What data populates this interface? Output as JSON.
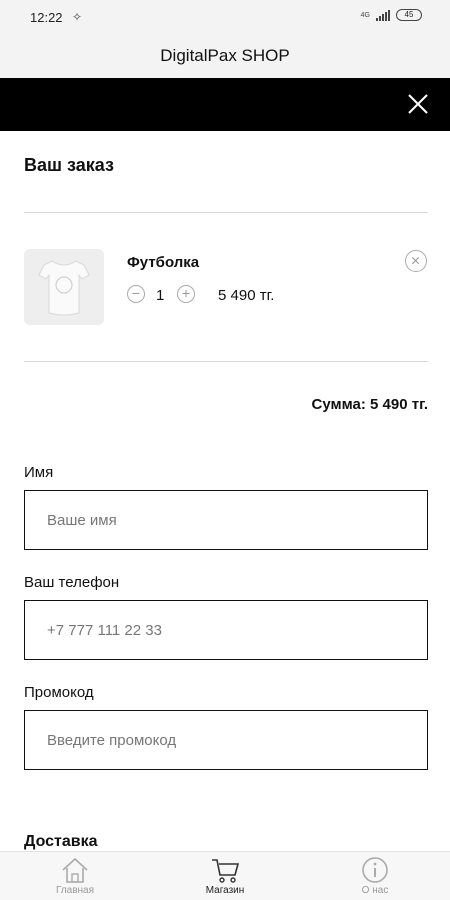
{
  "status_bar": {
    "time": "12:22",
    "battery": "45",
    "network": "4G"
  },
  "app": {
    "title": "DigitalPax SHOP"
  },
  "order": {
    "title": "Ваш заказ",
    "items": [
      {
        "name": "Футболка",
        "quantity": "1",
        "price": "5 490 тг.",
        "minus": "−",
        "plus": "+"
      }
    ],
    "total_label": "Сумма: 5 490 тг."
  },
  "form": {
    "name_label": "Имя",
    "name_placeholder": "Ваше имя",
    "phone_label": "Ваш телефон",
    "phone_placeholder": "+7 777 111 22 33",
    "promo_label": "Промокод",
    "promo_placeholder": "Введите промокод"
  },
  "delivery": {
    "title": "Доставка"
  },
  "nav": {
    "items": [
      {
        "label": "Главная",
        "icon": "home-icon",
        "active": false
      },
      {
        "label": "Магазин",
        "icon": "cart-icon",
        "active": true
      },
      {
        "label": "О нас",
        "icon": "info-icon",
        "active": false
      }
    ]
  },
  "colors": {
    "band": "#000000",
    "border": "#111111",
    "muted": "#999999"
  }
}
